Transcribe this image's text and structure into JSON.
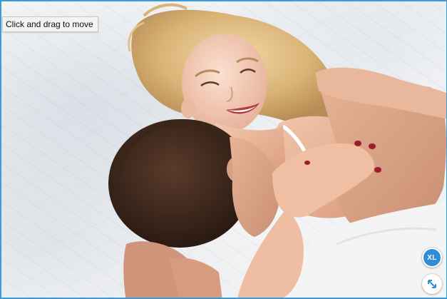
{
  "viewer": {
    "tooltip_text": "Click and drag to move",
    "xl_button_label": "XL",
    "expand_icon": "diagonal-expand-arrows-icon",
    "accent_color": "#2f8ed6",
    "border_color": "#3c9cd8"
  }
}
